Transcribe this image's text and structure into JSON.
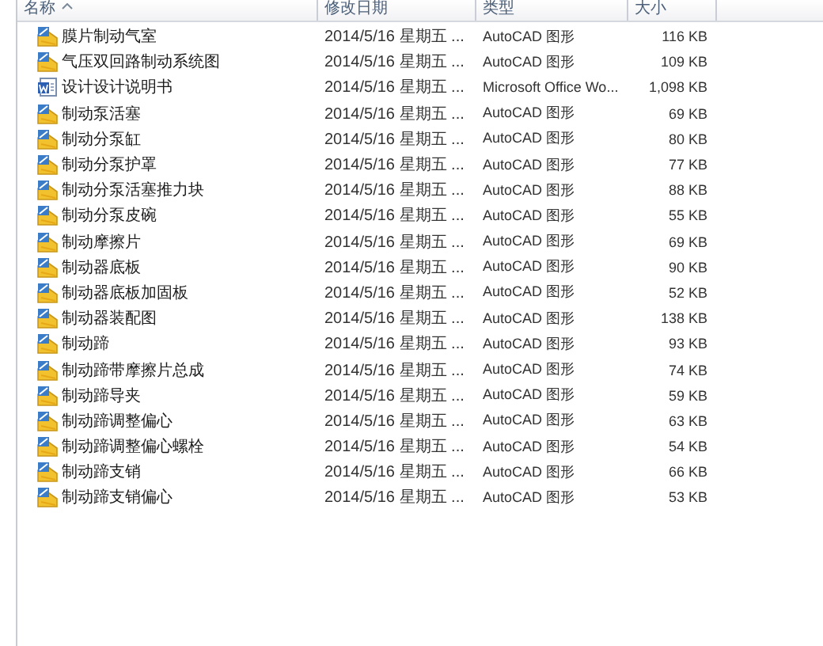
{
  "columns": [
    {
      "label": "名称",
      "sorted": true
    },
    {
      "label": "修改日期",
      "sorted": false
    },
    {
      "label": "类型",
      "sorted": false
    },
    {
      "label": "大小",
      "sorted": false
    }
  ],
  "rows": [
    {
      "kind": "dwg",
      "name": "膜片制动气室",
      "date": "2014/5/16 星期五 ...",
      "type": "AutoCAD 图形",
      "size": "116 KB"
    },
    {
      "kind": "dwg",
      "name": "气压双回路制动系统图",
      "date": "2014/5/16 星期五 ...",
      "type": "AutoCAD 图形",
      "size": "109 KB"
    },
    {
      "kind": "doc",
      "name": "设计设计说明书",
      "date": "2014/5/16 星期五 ...",
      "type": "Microsoft Office Wo...",
      "size": "1,098 KB"
    },
    {
      "kind": "dwg",
      "name": "制动泵活塞",
      "date": "2014/5/16 星期五 ...",
      "type": "AutoCAD 图形",
      "size": "69 KB"
    },
    {
      "kind": "dwg",
      "name": "制动分泵缸",
      "date": "2014/5/16 星期五 ...",
      "type": "AutoCAD 图形",
      "size": "80 KB"
    },
    {
      "kind": "dwg",
      "name": "制动分泵护罩",
      "date": "2014/5/16 星期五 ...",
      "type": "AutoCAD 图形",
      "size": "77 KB"
    },
    {
      "kind": "dwg",
      "name": "制动分泵活塞推力块",
      "date": "2014/5/16 星期五 ...",
      "type": "AutoCAD 图形",
      "size": "88 KB"
    },
    {
      "kind": "dwg",
      "name": "制动分泵皮碗",
      "date": "2014/5/16 星期五 ...",
      "type": "AutoCAD 图形",
      "size": "55 KB"
    },
    {
      "kind": "dwg",
      "name": "制动摩擦片",
      "date": "2014/5/16 星期五 ...",
      "type": "AutoCAD 图形",
      "size": "69 KB"
    },
    {
      "kind": "dwg",
      "name": "制动器底板",
      "date": "2014/5/16 星期五 ...",
      "type": "AutoCAD 图形",
      "size": "90 KB"
    },
    {
      "kind": "dwg",
      "name": "制动器底板加固板",
      "date": "2014/5/16 星期五 ...",
      "type": "AutoCAD 图形",
      "size": "52 KB"
    },
    {
      "kind": "dwg",
      "name": "制动器装配图",
      "date": "2014/5/16 星期五 ...",
      "type": "AutoCAD 图形",
      "size": "138 KB"
    },
    {
      "kind": "dwg",
      "name": "制动蹄",
      "date": "2014/5/16 星期五 ...",
      "type": "AutoCAD 图形",
      "size": "93 KB"
    },
    {
      "kind": "dwg",
      "name": "制动蹄带摩擦片总成",
      "date": "2014/5/16 星期五 ...",
      "type": "AutoCAD 图形",
      "size": "74 KB"
    },
    {
      "kind": "dwg",
      "name": "制动蹄导夹",
      "date": "2014/5/16 星期五 ...",
      "type": "AutoCAD 图形",
      "size": "59 KB"
    },
    {
      "kind": "dwg",
      "name": "制动蹄调整偏心",
      "date": "2014/5/16 星期五 ...",
      "type": "AutoCAD 图形",
      "size": "63 KB"
    },
    {
      "kind": "dwg",
      "name": "制动蹄调整偏心螺栓",
      "date": "2014/5/16 星期五 ...",
      "type": "AutoCAD 图形",
      "size": "54 KB"
    },
    {
      "kind": "dwg",
      "name": "制动蹄支销",
      "date": "2014/5/16 星期五 ...",
      "type": "AutoCAD 图形",
      "size": "66 KB"
    },
    {
      "kind": "dwg",
      "name": "制动蹄支销偏心",
      "date": "2014/5/16 星期五 ...",
      "type": "AutoCAD 图形",
      "size": "53 KB"
    }
  ]
}
